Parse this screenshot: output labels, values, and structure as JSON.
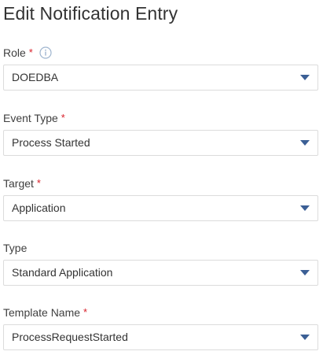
{
  "title": "Edit Notification Entry",
  "fields": [
    {
      "label": "Role",
      "required": true,
      "info": true,
      "value": "DOEDBA"
    },
    {
      "label": "Event Type",
      "required": true,
      "info": false,
      "value": "Process Started"
    },
    {
      "label": "Target",
      "required": true,
      "info": false,
      "value": "Application"
    },
    {
      "label": "Type",
      "required": false,
      "info": false,
      "value": "Standard Application"
    },
    {
      "label": "Template Name",
      "required": true,
      "info": false,
      "value": "ProcessRequestStarted"
    }
  ],
  "required_marker": "*",
  "colors": {
    "required": "#d8202a",
    "caret": "#3b5f95",
    "info_icon": "#9fb5cf",
    "border": "#dcdcdc"
  },
  "icons": {
    "info": "info-circle-icon",
    "dropdown": "chevron-down-icon"
  }
}
